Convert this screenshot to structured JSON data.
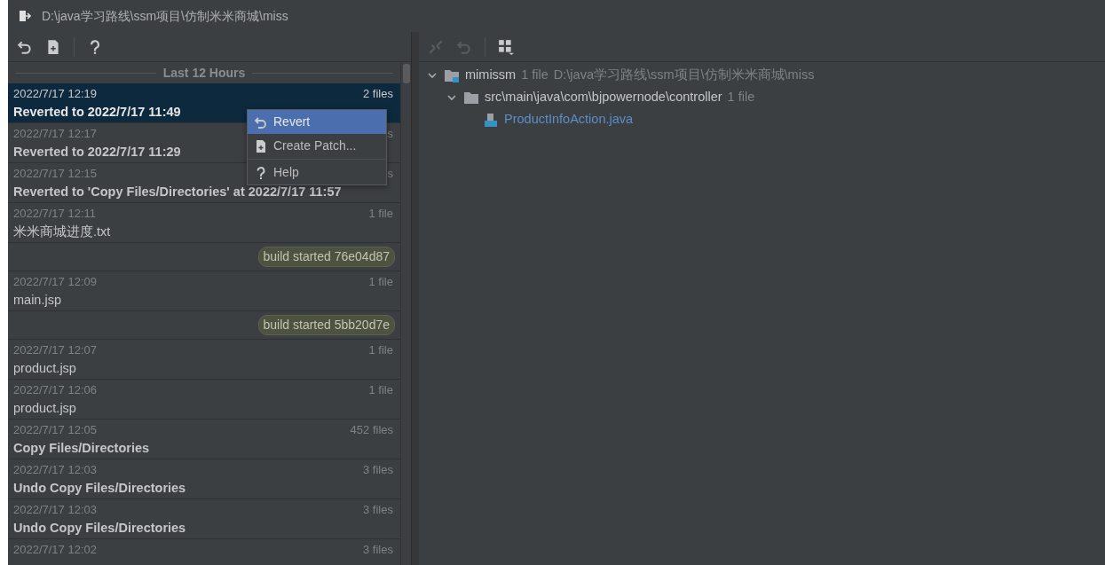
{
  "window": {
    "title": "D:\\java学习路线\\ssm项目\\仿制米米商城\\miss"
  },
  "toolbar": {
    "buttons": [
      {
        "kind": "revert"
      },
      {
        "kind": "patch"
      },
      {
        "kind": "help"
      }
    ]
  },
  "history": {
    "group_header": "Last 12 Hours",
    "rows": [
      {
        "kind": "change",
        "time": "2022/7/17 12:19",
        "count": "2 files",
        "title": "Reverted to 2022/7/17 11:49",
        "bold": true,
        "selected": true
      },
      {
        "kind": "change",
        "time": "2022/7/17 12:17",
        "count": "s",
        "title": "Reverted to 2022/7/17 11:29",
        "bold": true,
        "selected": false
      },
      {
        "kind": "change",
        "time": "2022/7/17 12:15",
        "count": "s",
        "title": "Reverted to 'Copy Files/Directories' at 2022/7/17 11:57",
        "bold": true,
        "selected": false
      },
      {
        "kind": "change",
        "time": "2022/7/17 12:11",
        "count": "1 file",
        "title": "米米商城进度.txt",
        "bold": false,
        "selected": false
      },
      {
        "kind": "label",
        "text": "build started 76e04d87"
      },
      {
        "kind": "change",
        "time": "2022/7/17 12:09",
        "count": "1 file",
        "title": "main.jsp",
        "bold": false,
        "selected": false
      },
      {
        "kind": "label",
        "text": "build started 5bb20d7e"
      },
      {
        "kind": "change",
        "time": "2022/7/17 12:07",
        "count": "1 file",
        "title": "product.jsp",
        "bold": false,
        "selected": false
      },
      {
        "kind": "change",
        "time": "2022/7/17 12:06",
        "count": "1 file",
        "title": "product.jsp",
        "bold": false,
        "selected": false
      },
      {
        "kind": "change",
        "time": "2022/7/17 12:05",
        "count": "452 files",
        "title": "Copy Files/Directories",
        "bold": true,
        "selected": false
      },
      {
        "kind": "change",
        "time": "2022/7/17 12:03",
        "count": "3 files",
        "title": "Undo Copy Files/Directories",
        "bold": true,
        "selected": false
      },
      {
        "kind": "change",
        "time": "2022/7/17 12:03",
        "count": "3 files",
        "title": "Undo Copy Files/Directories",
        "bold": true,
        "selected": false
      },
      {
        "kind": "change",
        "time": "2022/7/17 12:02",
        "count": "3 files",
        "selected": false
      }
    ]
  },
  "context_menu": {
    "items": [
      {
        "kind": "revert",
        "label": "Revert",
        "selected": true
      },
      {
        "kind": "patch",
        "label": "Create Patch...",
        "selected": false
      },
      {
        "kind": "help",
        "label": "Help",
        "selected": false
      }
    ]
  },
  "right_toolbar": {
    "buttons": [
      {
        "kind": "diff",
        "disabled": true
      },
      {
        "kind": "revert",
        "disabled": true
      },
      {
        "kind": "group",
        "disabled": false
      }
    ]
  },
  "tree": [
    {
      "kind": "module",
      "name": "mimissm",
      "count": "1 file",
      "path": "D:\\java学习路线\\ssm项目\\仿制米米商城\\miss",
      "expanded": true,
      "children": [
        {
          "kind": "folder",
          "name": "src\\main\\java\\com\\bjpowernode\\controller",
          "count": "1 file",
          "expanded": true,
          "children": [
            {
              "kind": "java",
              "name": "ProductInfoAction.java"
            }
          ]
        }
      ]
    }
  ]
}
